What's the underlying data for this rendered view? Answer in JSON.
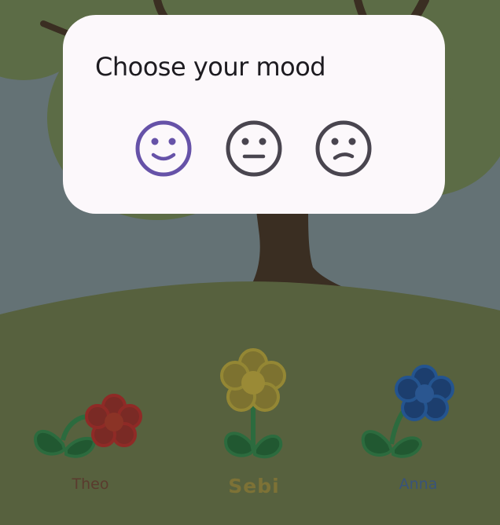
{
  "dialog": {
    "title": "Choose your mood",
    "moods": [
      {
        "id": "happy",
        "selected": true,
        "icon": "smiley-happy-icon"
      },
      {
        "id": "neutral",
        "selected": false,
        "icon": "smiley-neutral-icon"
      },
      {
        "id": "sad",
        "selected": false,
        "icon": "smiley-sad-icon"
      }
    ]
  },
  "flowers": [
    {
      "name": "Theo",
      "color": "#8f2a26"
    },
    {
      "name": "Sebi",
      "color": "#a4922c"
    },
    {
      "name": "Anna",
      "color": "#1f4f8a"
    }
  ],
  "colors": {
    "sky": "#647275",
    "tree_canopy": "#5c6c46",
    "trunk": "#3a2e22",
    "grass": "#57613e",
    "stem_leaf": "#2c6b3e",
    "selected_mood": "#6652a8",
    "mood_icon": "#49454f",
    "dialog_bg": "#fcf8fb"
  }
}
